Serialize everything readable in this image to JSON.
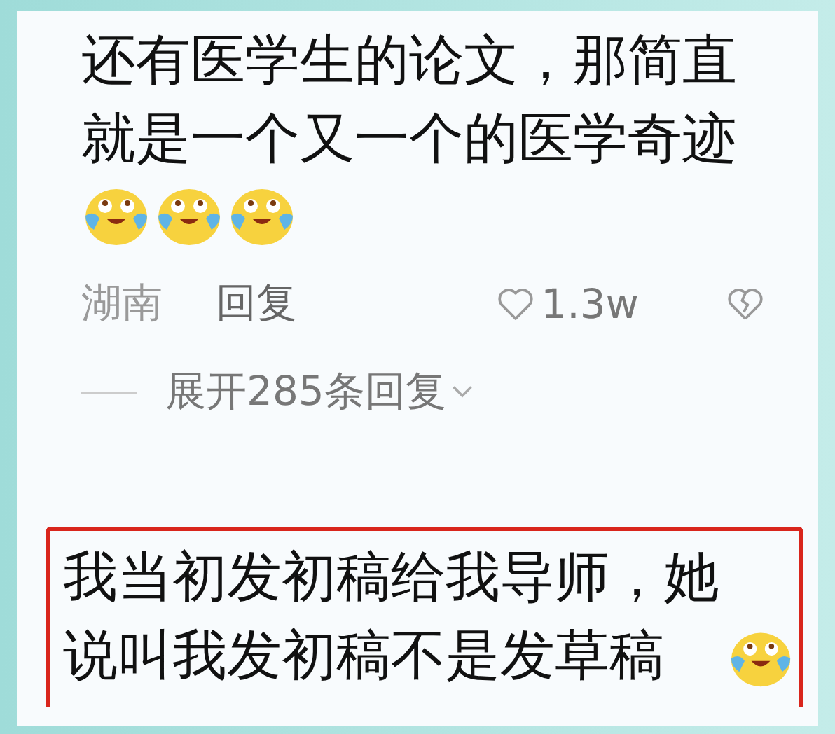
{
  "comments": [
    {
      "text": "还有医学生的论文，那简直就是一个又一个的医学奇迹",
      "emojis": [
        {
          "kind": "tears-of-joy"
        },
        {
          "kind": "tears-of-joy"
        },
        {
          "kind": "tears-of-joy"
        }
      ],
      "highlighted": false,
      "location": "湖南",
      "reply_label": "回复",
      "likes": "1.3w",
      "expand_replies": "展开285条回复"
    },
    {
      "text": "我当初发初稿给我导师，她说叫我发初稿不是发草稿",
      "emojis": [
        {
          "kind": "tears-of-joy"
        }
      ],
      "highlighted": true
    }
  ]
}
